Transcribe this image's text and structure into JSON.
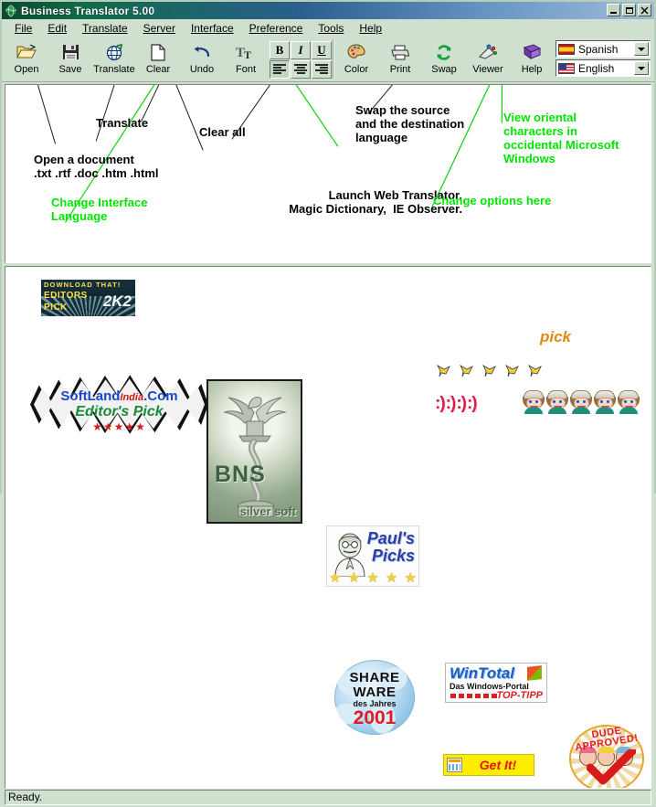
{
  "window": {
    "title": "Business Translator 5.00",
    "icon": "globe-icon",
    "minimize": "–",
    "maximize": "□",
    "close": "✕",
    "titlebar_gradient_start": "#0a4a32",
    "titlebar_gradient_end": "#9fbcd8"
  },
  "menu": {
    "items": [
      {
        "label": "File"
      },
      {
        "label": "Edit"
      },
      {
        "label": "Translate"
      },
      {
        "label": "Server"
      },
      {
        "label": "Interface"
      },
      {
        "label": "Preference"
      },
      {
        "label": "Tools"
      },
      {
        "label": "Help"
      }
    ]
  },
  "toolbar": {
    "buttons": [
      {
        "label": "Open",
        "icon": "open-folder-icon"
      },
      {
        "label": "Save",
        "icon": "floppy-disk-icon"
      },
      {
        "label": "Translate",
        "icon": "globe-translate-icon"
      },
      {
        "label": "Clear",
        "icon": "blank-page-icon"
      },
      {
        "label": "Undo",
        "icon": "undo-arrow-icon"
      },
      {
        "label": "Font",
        "icon": "font-tt-icon"
      },
      {
        "label": "Color",
        "icon": "palette-icon"
      },
      {
        "label": "Print",
        "icon": "printer-icon"
      },
      {
        "label": "Swap",
        "icon": "swap-arrows-icon"
      },
      {
        "label": "Viewer",
        "icon": "viewer-icon"
      },
      {
        "label": "Help",
        "icon": "help-book-icon"
      }
    ],
    "format_buttons": [
      {
        "label": "B",
        "name": "bold-button"
      },
      {
        "label": "I",
        "name": "italic-button"
      },
      {
        "label": "U",
        "name": "underline-button"
      }
    ],
    "align_buttons": [
      {
        "name": "align-left-button"
      },
      {
        "name": "align-center-button"
      },
      {
        "name": "align-right-button"
      }
    ]
  },
  "languages": {
    "source": {
      "label": "Spanish",
      "flag": "spain-flag-icon"
    },
    "target": {
      "label": "English",
      "flag": "usa-flag-icon"
    }
  },
  "annotations": {
    "accent_green": "#00e500",
    "accent_black": "#000000",
    "items": [
      {
        "id": "translate",
        "text": "Translate",
        "color": "black"
      },
      {
        "id": "open-document",
        "text": "Open a document\n.txt .rtf .doc .htm .html",
        "color": "black"
      },
      {
        "id": "clear-all",
        "text": "Clear all",
        "color": "black"
      },
      {
        "id": "swap-languages",
        "text": "Swap the source\nand the destination\nlanguage",
        "color": "black"
      },
      {
        "id": "view-oriental",
        "text": "View oriental\ncharacters in\noccidental Microsoft\nWindows",
        "color": "green"
      },
      {
        "id": "change-interface",
        "text": "Change Interface\nLanguage",
        "color": "green"
      },
      {
        "id": "launch-web",
        "text": "Launch Web Translator,\nMagic Dictionary,  IE Observer.",
        "color": "black"
      },
      {
        "id": "change-options",
        "text": "Change options here",
        "color": "green"
      }
    ]
  },
  "awards": {
    "download_that": {
      "line1": "DOWNLOAD THAT!",
      "line2": "EDITORS",
      "line3": "PICK",
      "line4": "2K2"
    },
    "softlandindia": {
      "name_a": "SoftLand",
      "name_b": "India",
      "name_c": ".Com",
      "subtitle": "Editor's Pick",
      "stars": "★★★★★"
    },
    "bns": {
      "title": "BNS",
      "subtitle": "silver soft"
    },
    "pauls_picks": {
      "line1": "Paul's",
      "line2": "Picks",
      "stars": [
        "★",
        "★",
        "★",
        "★",
        "★"
      ]
    },
    "shareware": {
      "line1": "SHARE",
      "line2": "WARE",
      "line3": "des Jahres",
      "line4": "2001"
    },
    "wintotal": {
      "line1": "WinTotal",
      "line2": "Das Windows-Portal",
      "line3": "TOP-TIPP"
    },
    "get_it": {
      "label": "Get It!",
      "pick_label": "pick",
      "icon": "app-window-icon"
    },
    "dude_approved": {
      "line1": "DUDE",
      "line2": "APPROVED!",
      "check": "check-mark-icon"
    },
    "birds": {
      "icon": "dove-icon",
      "count": 5,
      "glyph": "🕊"
    },
    "smileys": {
      "glyph": ":)",
      "count": 4
    },
    "avatars": {
      "icon": "cartoon-face-icon",
      "count": 5
    }
  },
  "status": {
    "text": "Ready."
  }
}
